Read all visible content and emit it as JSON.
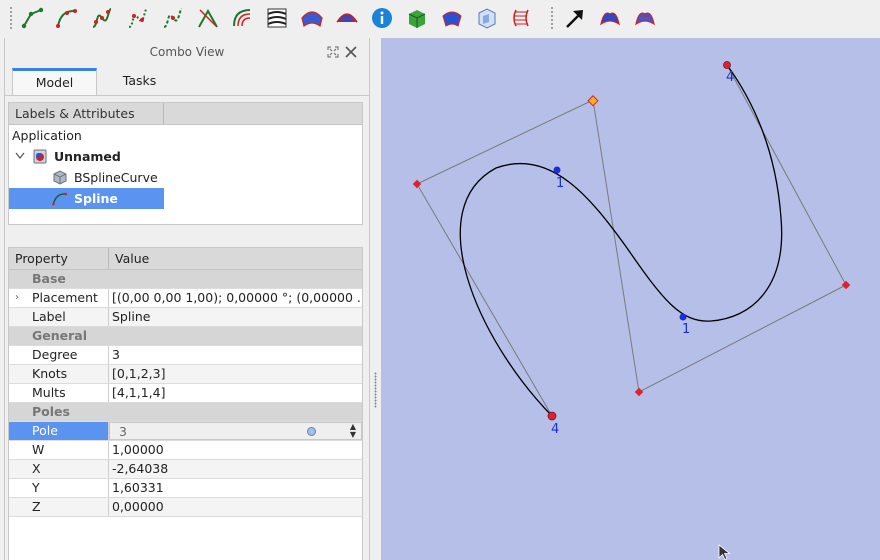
{
  "toolbar": {
    "buttons": [
      "bspline-poles-icon",
      "bspline-degree-icon",
      "bspline-knots-icon",
      "bspline-weights-icon",
      "bspline-increase-icon",
      "arc-icon",
      "ruled-surface-icon",
      "zebra-icon",
      "surface-icon",
      "surface-filling-icon",
      "info-icon",
      "box-icon",
      "surface-extend-icon",
      "section-icon",
      "ruled-icon",
      "pointer-icon",
      "surface-sections-icon",
      "surface-blend-icon"
    ]
  },
  "combo": {
    "title": "Combo View",
    "tabs": [
      {
        "label": "Model",
        "active": true
      },
      {
        "label": "Tasks",
        "active": false
      }
    ]
  },
  "tree": {
    "header": "Labels & Attributes",
    "section": "Application",
    "document": "Unnamed",
    "items": [
      {
        "label": "BSplineCurve",
        "selected": false
      },
      {
        "label": "Spline",
        "selected": true
      }
    ]
  },
  "properties": {
    "header_property": "Property",
    "header_value": "Value",
    "rows": [
      {
        "kind": "group",
        "name": "Base"
      },
      {
        "kind": "prop",
        "name": "Placement",
        "value": "[(0,00 0,00 1,00); 0,00000 °; (0,00000 ...",
        "expandable": true
      },
      {
        "kind": "prop",
        "name": "Label",
        "value": "Spline"
      },
      {
        "kind": "group",
        "name": "General"
      },
      {
        "kind": "prop",
        "name": "Degree",
        "value": "3"
      },
      {
        "kind": "prop",
        "name": "Knots",
        "value": "[0,1,2,3]"
      },
      {
        "kind": "prop",
        "name": "Mults",
        "value": "[4,1,1,4]"
      },
      {
        "kind": "group",
        "name": "Poles"
      },
      {
        "kind": "edit",
        "name": "Pole",
        "value": "3"
      },
      {
        "kind": "prop",
        "name": "W",
        "value": "1,00000"
      },
      {
        "kind": "prop",
        "name": "X",
        "value": "-2,64038"
      },
      {
        "kind": "prop",
        "name": "Y",
        "value": "1,60331"
      },
      {
        "kind": "prop",
        "name": "Z",
        "value": "0,00000"
      }
    ]
  },
  "viewport": {
    "background": "#b6bfe7",
    "knot_labels": [
      "4",
      "1",
      "1",
      "4"
    ],
    "pole_color": "#e0202a",
    "knot_color": "#1a2fd8",
    "selected_pole_color": "#f0b020"
  }
}
